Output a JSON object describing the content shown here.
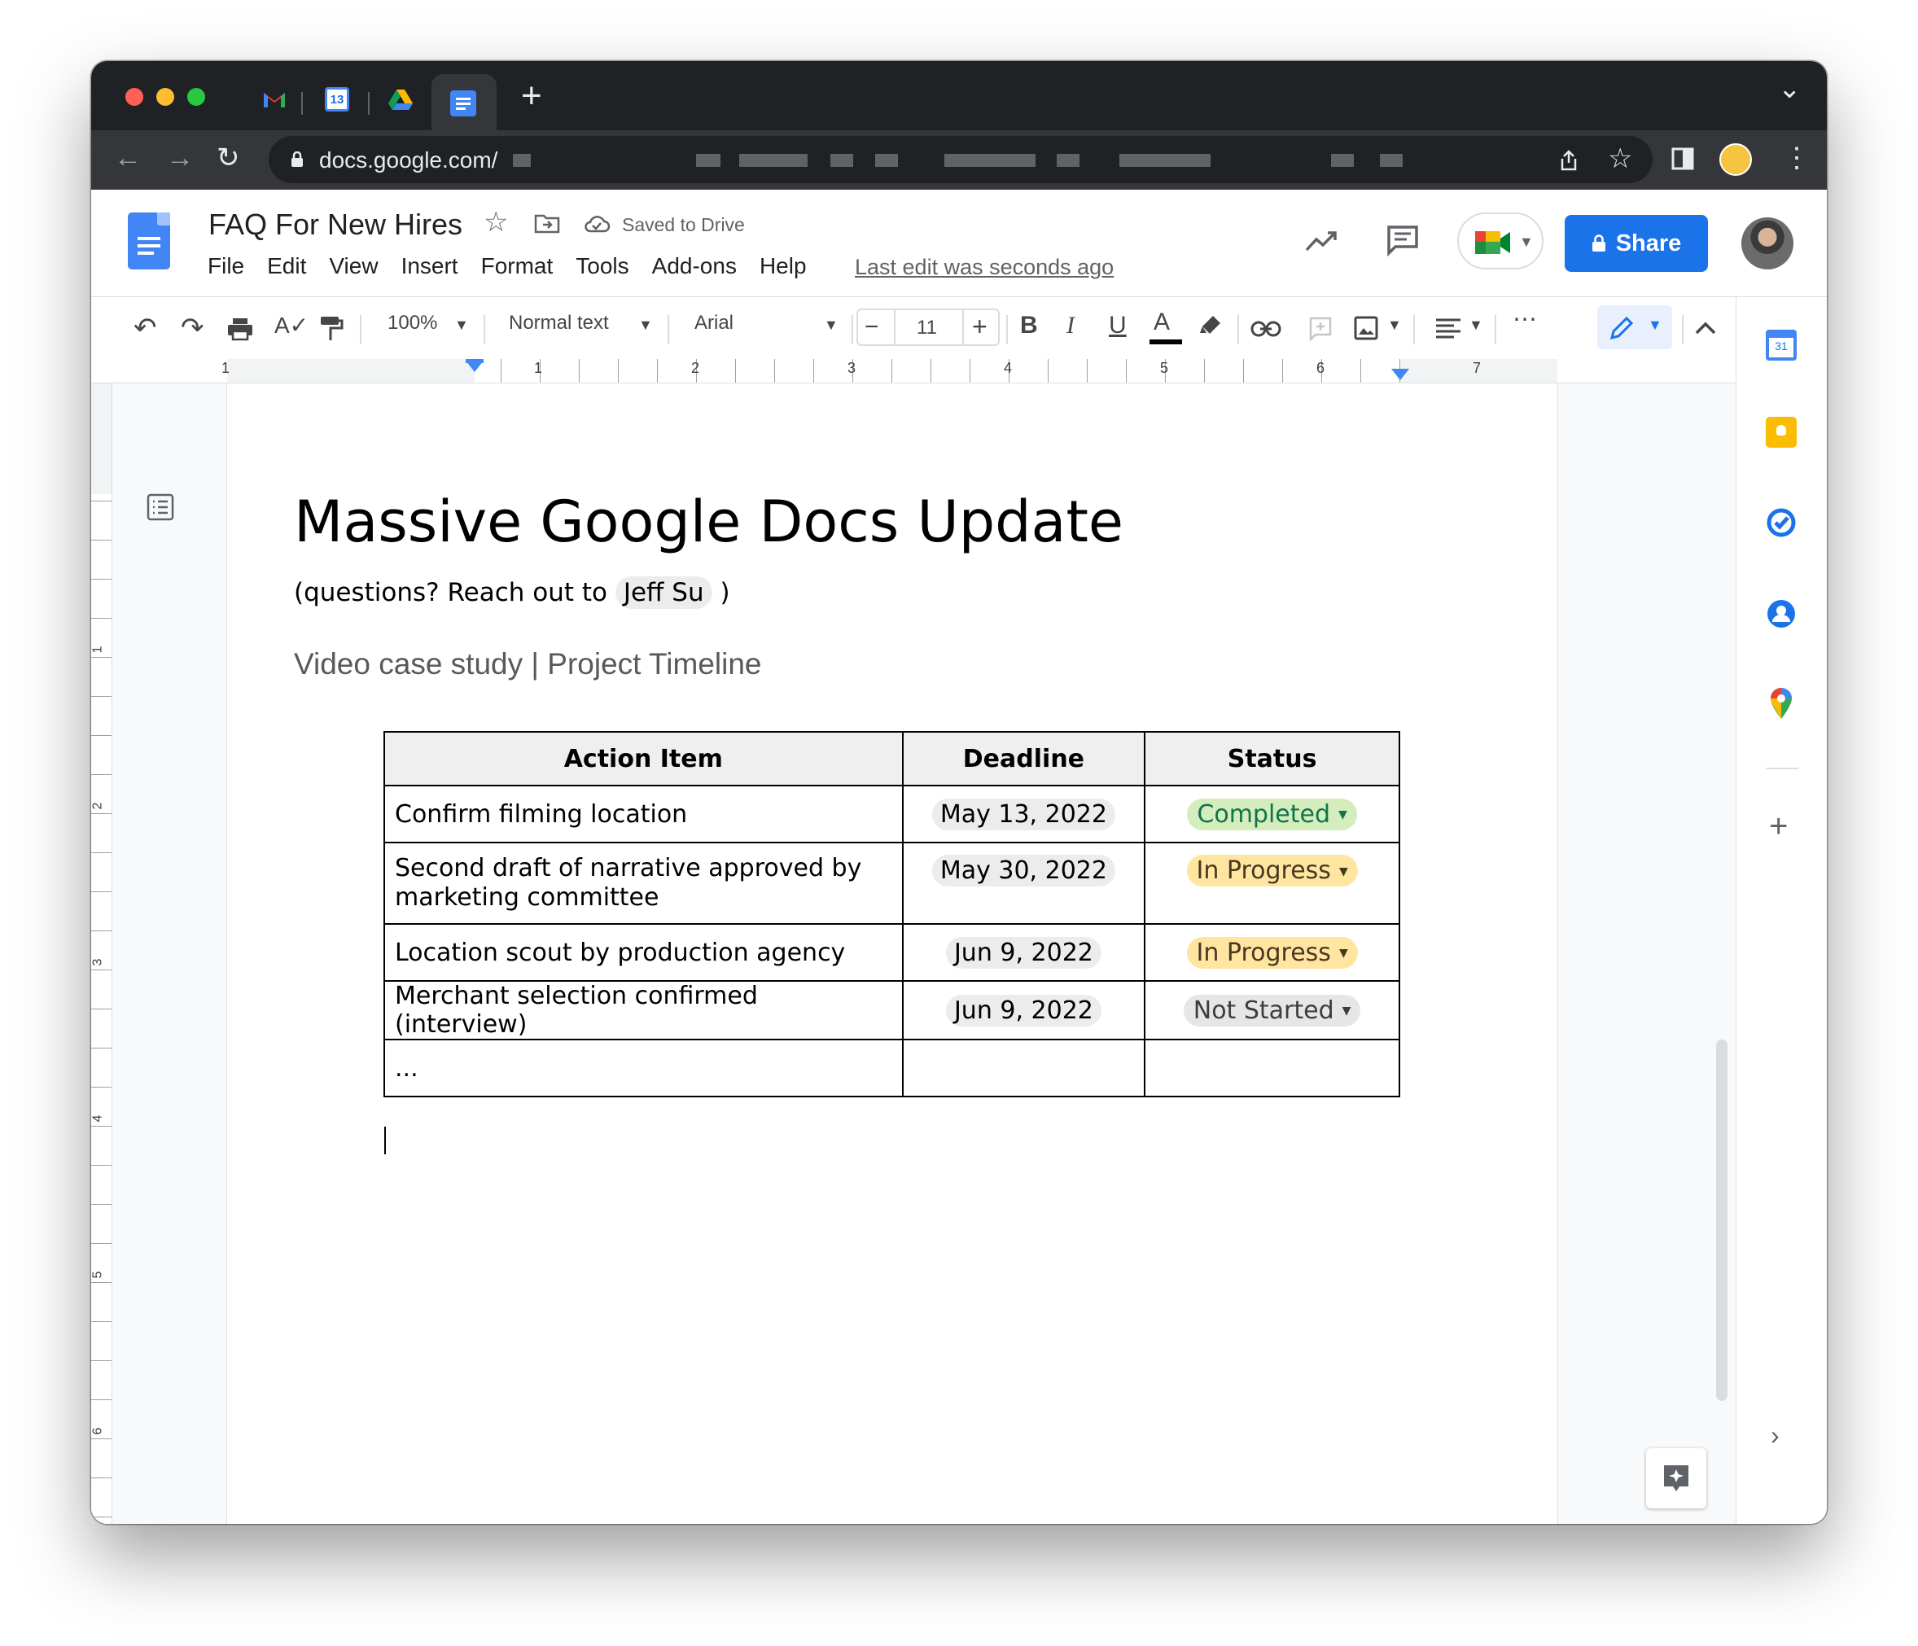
{
  "browser": {
    "url": "docs.google.com/",
    "tabs": [
      "Gmail",
      "Calendar",
      "Drive",
      "Docs"
    ],
    "calendar_tab_date": "13",
    "new_tab": "+",
    "tab_menu": "⌄"
  },
  "docs_header": {
    "title": "FAQ For New Hires",
    "saved_status": "Saved to Drive",
    "menu": [
      "File",
      "Edit",
      "View",
      "Insert",
      "Format",
      "Tools",
      "Add-ons",
      "Help"
    ],
    "last_edit": "Last edit was seconds ago",
    "share_label": "Share"
  },
  "toolbar": {
    "zoom": "100%",
    "style": "Normal text",
    "font": "Arial",
    "font_size": "11",
    "bold": "B",
    "italic": "I",
    "underline": "U",
    "text_color": "A",
    "more": "⋯"
  },
  "ruler": {
    "h_numbers": [
      "1",
      "1",
      "2",
      "3",
      "4",
      "5",
      "6",
      "7"
    ],
    "v_numbers": [
      "1",
      "2",
      "3",
      "4",
      "5",
      "6"
    ]
  },
  "side_panel": {
    "calendar_date": "31",
    "add": "+"
  },
  "document": {
    "title": "Massive Google Docs Update",
    "contact_prefix": "(questions? Reach out to ",
    "contact_name": "Jeff Su",
    "contact_suffix": " )",
    "subtitle": "Video case study | Project Timeline",
    "table": {
      "headers": [
        "Action Item",
        "Deadline",
        "Status"
      ],
      "rows": [
        {
          "item": "Confirm filming location",
          "deadline": "May 13, 2022",
          "status": "Completed"
        },
        {
          "item": "Second draft of narrative approved by marketing committee",
          "deadline": "May 30, 2022",
          "status": "In Progress"
        },
        {
          "item": "Location scout by production agency",
          "deadline": "Jun 9, 2022",
          "status": "In Progress"
        },
        {
          "item": "Merchant selection confirmed (interview)",
          "deadline": "Jun 9, 2022",
          "status": "Not Started"
        },
        {
          "item": "...",
          "deadline": "",
          "status": ""
        }
      ]
    }
  },
  "colors": {
    "completed_bg": "#d4edbc",
    "completed_text": "#11734b",
    "in_progress_bg": "#ffe5a0",
    "in_progress_text": "#473821",
    "not_started_bg": "#e6e6e6",
    "not_started_text": "#3d3d3d",
    "accent": "#1a73e8"
  }
}
